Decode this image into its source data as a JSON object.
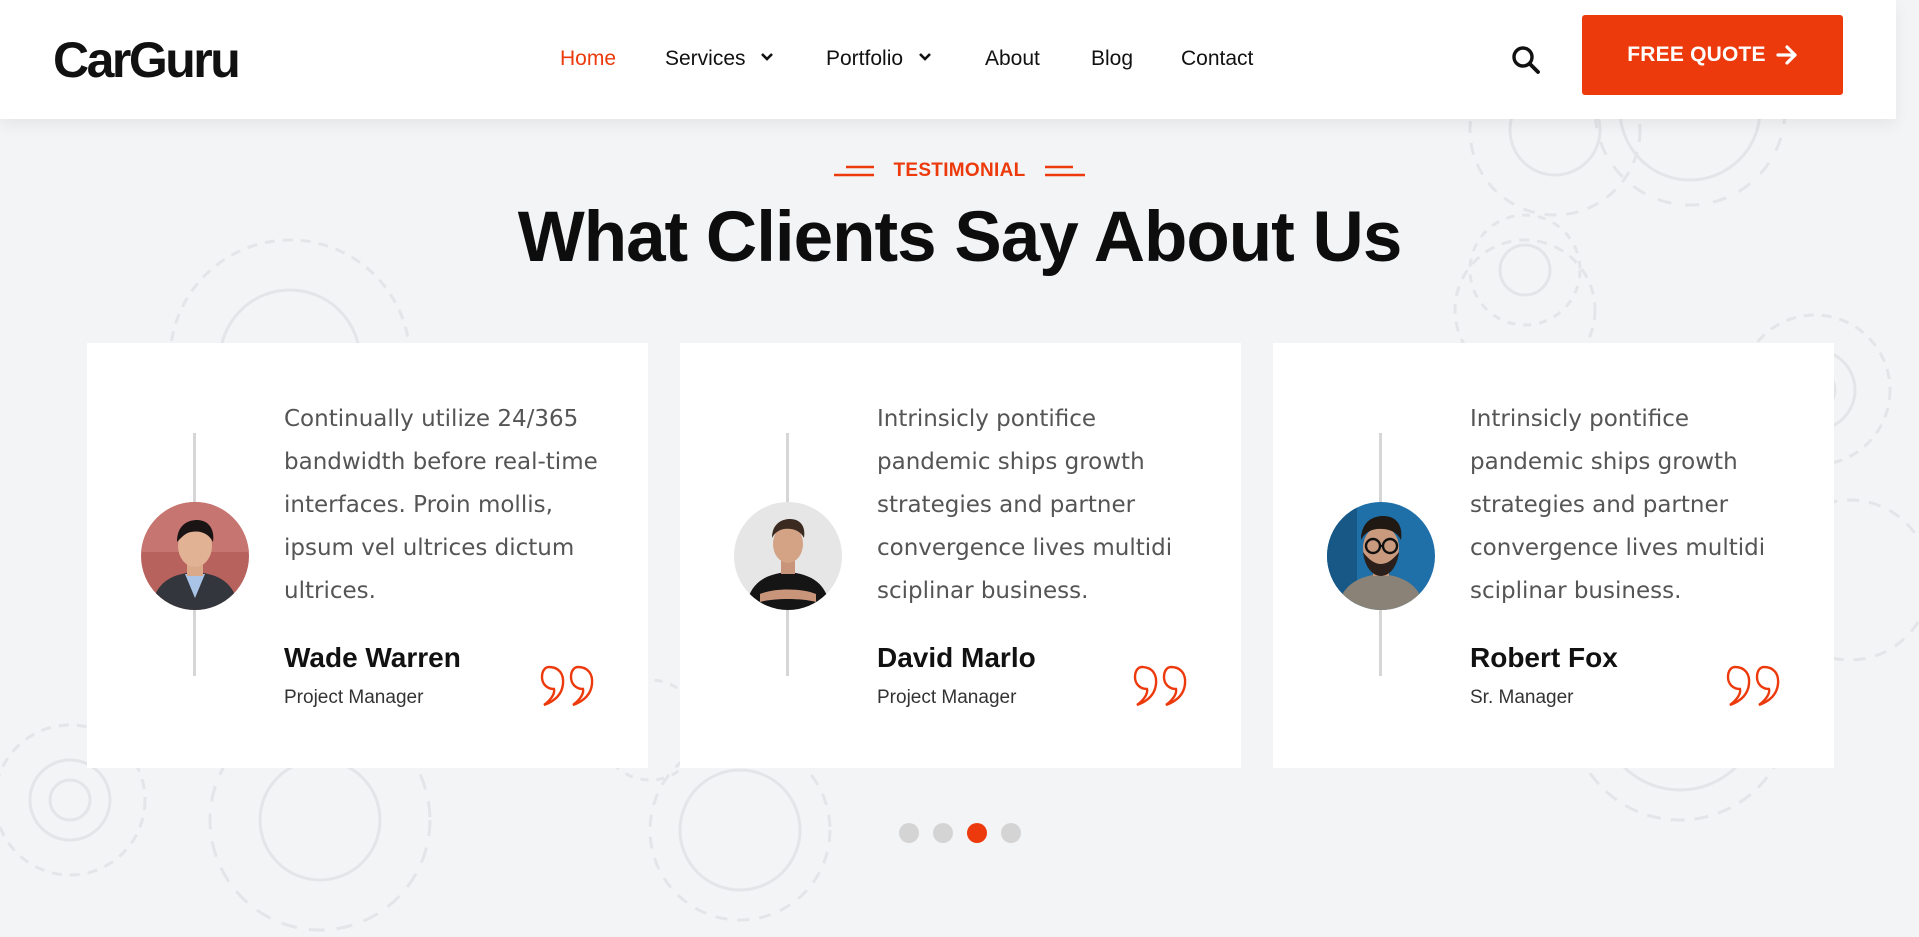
{
  "colors": {
    "accent": "#ec3a0c",
    "background": "#f3f4f6",
    "card": "#ffffff"
  },
  "header": {
    "logo": "CarGuru",
    "nav": [
      {
        "label": "Home",
        "active": true,
        "dropdown": false
      },
      {
        "label": "Services",
        "active": false,
        "dropdown": true
      },
      {
        "label": "Portfolio",
        "active": false,
        "dropdown": true
      },
      {
        "label": "About",
        "active": false,
        "dropdown": false
      },
      {
        "label": "Blog",
        "active": false,
        "dropdown": false
      },
      {
        "label": "Contact",
        "active": false,
        "dropdown": false
      }
    ],
    "search_icon": "search-icon",
    "cta_label": "FREE QUOTE",
    "cta_icon": "arrow-right-icon"
  },
  "section": {
    "eyebrow": "TESTIMONIAL",
    "title": "What Clients Say About Us"
  },
  "testimonials": [
    {
      "text": "Continually utilize 24/365 bandwidth before real-time interfaces. Proin mollis, ipsum vel ultrices dictum ultrices.",
      "name": "Wade Warren",
      "role": "Project Manager"
    },
    {
      "text": "Intrinsicly pontifice pandemic ships growth strategies and partner convergence lives multidi sciplinar business.",
      "name": "David Marlo",
      "role": "Project Manager"
    },
    {
      "text": "Intrinsicly pontifice pandemic ships growth strategies and partner convergence lives multidi sciplinar business.",
      "name": "Robert Fox",
      "role": "Sr. Manager"
    }
  ],
  "pagination": {
    "count": 4,
    "active_index": 2
  }
}
